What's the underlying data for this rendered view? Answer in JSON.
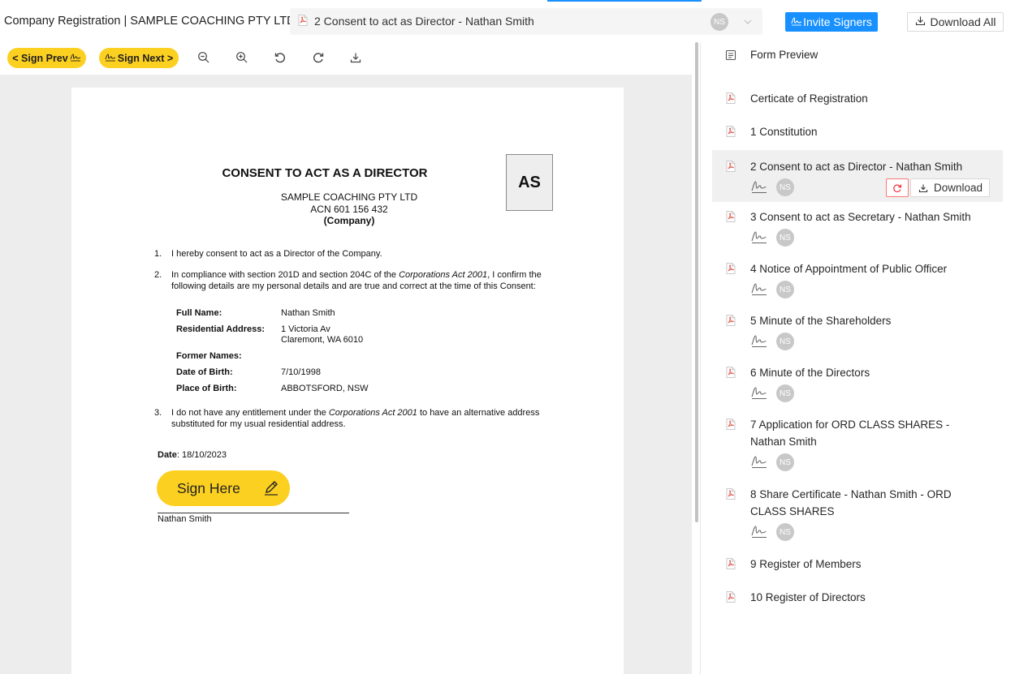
{
  "header": {
    "app_title": "Company Registration | SAMPLE COACHING PTY LTD",
    "current_document": "2 Consent to act as Director - Nathan Smith",
    "signer_initials": "NS",
    "invite_label": "Invite Signers",
    "download_all_label": "Download All"
  },
  "toolbar": {
    "sign_prev_label": "< Sign Prev",
    "sign_next_label": "Sign Next >",
    "icons": [
      "zoom-out-icon",
      "zoom-in-icon",
      "rotate-left-icon",
      "rotate-right-icon",
      "download-icon"
    ]
  },
  "document": {
    "title": "CONSENT TO ACT AS A DIRECTOR",
    "stamp": "AS",
    "company_name": "SAMPLE COACHING PTY LTD",
    "acn": "ACN 601 156 432",
    "company_tag": "(Company)",
    "item1_num": "1.",
    "item1": "I hereby consent to act as a Director of the Company.",
    "item2_num": "2.",
    "item2_a": "In compliance with section 201D and section 204C of the ",
    "item2_italic": "Corporations Act 2001",
    "item2_b": ", I confirm the following details are my personal details and are true and correct at the time of this Consent:",
    "details": {
      "full_name_label": "Full Name:",
      "full_name": "Nathan Smith",
      "address_label": "Residential Address:",
      "address_line1": "1 Victoria Av",
      "address_line2": "Claremont, WA 6010",
      "former_names_label": "Former Names:",
      "dob_label": "Date of Birth:",
      "dob": "7/10/1998",
      "pob_label": "Place of Birth:",
      "pob": "ABBOTSFORD, NSW"
    },
    "item3_num": "3.",
    "item3_a": "I do not have any entitlement under the ",
    "item3_italic": "Corporations Act 2001",
    "item3_b": " to have an alternative address substituted for my usual residential address.",
    "date_label": "Date",
    "date_value": ": 18/10/2023",
    "sign_here_label": "Sign Here",
    "signer_name": "Nathan Smith"
  },
  "sidebar": {
    "form_preview_label": "Form Preview",
    "download_label": "Download",
    "items": [
      {
        "name": "Certicate of Registration",
        "signers": false
      },
      {
        "name": "1 Constitution",
        "signers": false
      },
      {
        "name": "2 Consent to act as Director - Nathan Smith",
        "signers": true,
        "initials": "NS",
        "active": true
      },
      {
        "name": "3 Consent to act as Secretary - Nathan Smith",
        "signers": true,
        "initials": "NS"
      },
      {
        "name": "4 Notice of Appointment of Public Officer",
        "signers": true,
        "initials": "NS"
      },
      {
        "name": "5 Minute of the Shareholders",
        "signers": true,
        "initials": "NS"
      },
      {
        "name": "6 Minute of the Directors",
        "signers": true,
        "initials": "NS"
      },
      {
        "name": "7 Application for ORD CLASS SHARES -",
        "name_line2": "Nathan Smith",
        "signers": true,
        "initials": "NS"
      },
      {
        "name": "8 Share Certificate - Nathan Smith - ORD",
        "name_line2": "CLASS SHARES",
        "signers": true,
        "initials": "NS"
      },
      {
        "name": "9 Register of Members",
        "signers": false
      },
      {
        "name": "10 Register of Directors",
        "signers": false
      }
    ]
  },
  "colors": {
    "accent_blue": "#1890ff",
    "sign_yellow": "#fcd021",
    "pdf_red": "#e2574c",
    "viewer_bg": "#ededee"
  }
}
